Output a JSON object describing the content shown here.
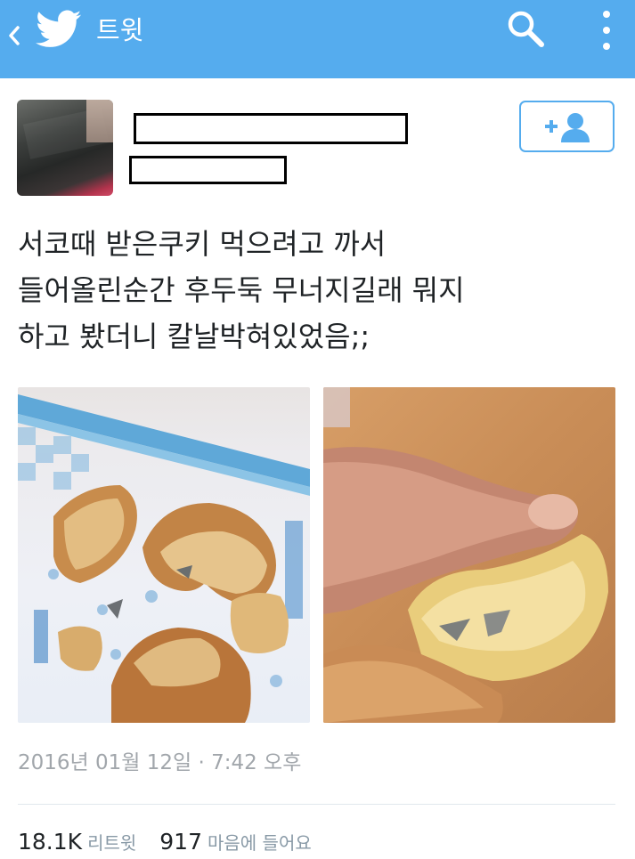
{
  "header": {
    "title": "트윗",
    "accent_color": "#55acee",
    "icons": [
      "chevron-left-icon",
      "twitter-bird-icon",
      "search-icon",
      "more-vertical-icon"
    ]
  },
  "tweet": {
    "text": "서코때 받은쿠키 먹으려고 까서\n들어올린순간 후두둑 무너지길래 뭐지\n하고 봤더니 칼날박혀있었음;;",
    "timestamp": "2016년 01월 12일 · 7:42 오후"
  },
  "stats": {
    "retweets": "18.1K",
    "retweets_label": "리트윗",
    "likes": "917",
    "likes_label": "마음에 들어요"
  }
}
